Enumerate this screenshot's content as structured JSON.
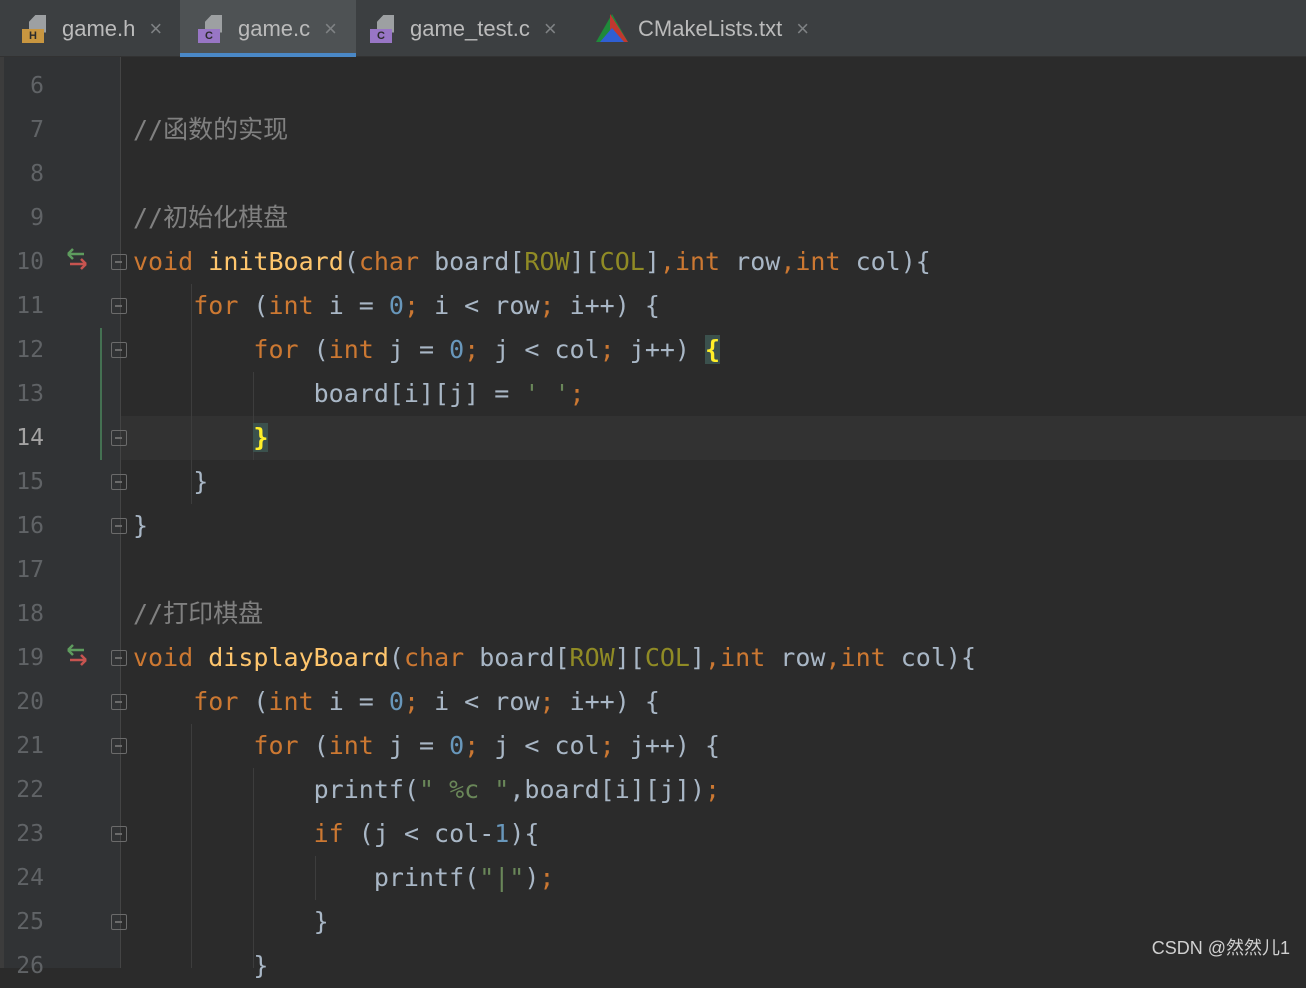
{
  "tabs": [
    {
      "label": "game.h",
      "badge": "H",
      "badge_color": "#c89640",
      "active": false
    },
    {
      "label": "game.c",
      "badge": "C",
      "badge_color": "#9876c5",
      "active": true
    },
    {
      "label": "game_test.c",
      "badge": "C",
      "badge_color": "#9876c5",
      "active": false
    },
    {
      "label": "CMakeLists.txt",
      "badge": "",
      "active": false
    }
  ],
  "close_glyph": "×",
  "lines": [
    {
      "n": "6"
    },
    {
      "n": "7"
    },
    {
      "n": "8"
    },
    {
      "n": "9"
    },
    {
      "n": "10"
    },
    {
      "n": "11"
    },
    {
      "n": "12"
    },
    {
      "n": "13"
    },
    {
      "n": "14"
    },
    {
      "n": "15"
    },
    {
      "n": "16"
    },
    {
      "n": "17"
    },
    {
      "n": "18"
    },
    {
      "n": "19"
    },
    {
      "n": "20"
    },
    {
      "n": "21"
    },
    {
      "n": "22"
    },
    {
      "n": "23"
    },
    {
      "n": "24"
    },
    {
      "n": "25"
    },
    {
      "n": "26"
    }
  ],
  "code": {
    "l7_comment": "//函数的实现",
    "l9_comment": "//初始化棋盘",
    "l18_comment": "//打印棋盘",
    "t_void": "void",
    "t_char": "char",
    "t_int": "int",
    "t_for": "for",
    "t_if": "if",
    "fn_init": "initBoard",
    "fn_display": "displayBoard",
    "fn_printf": "printf",
    "m_row": "ROW",
    "m_col": "COL",
    "zero": "0",
    "one": "1",
    "s_space": "' '",
    "s_fmt_q1": "\"",
    "s_fmt": " %c ",
    "s_fmt_q2": "\"",
    "s_bar": "\"|\""
  },
  "watermark": "CSDN @然然儿1",
  "current_line": "14"
}
